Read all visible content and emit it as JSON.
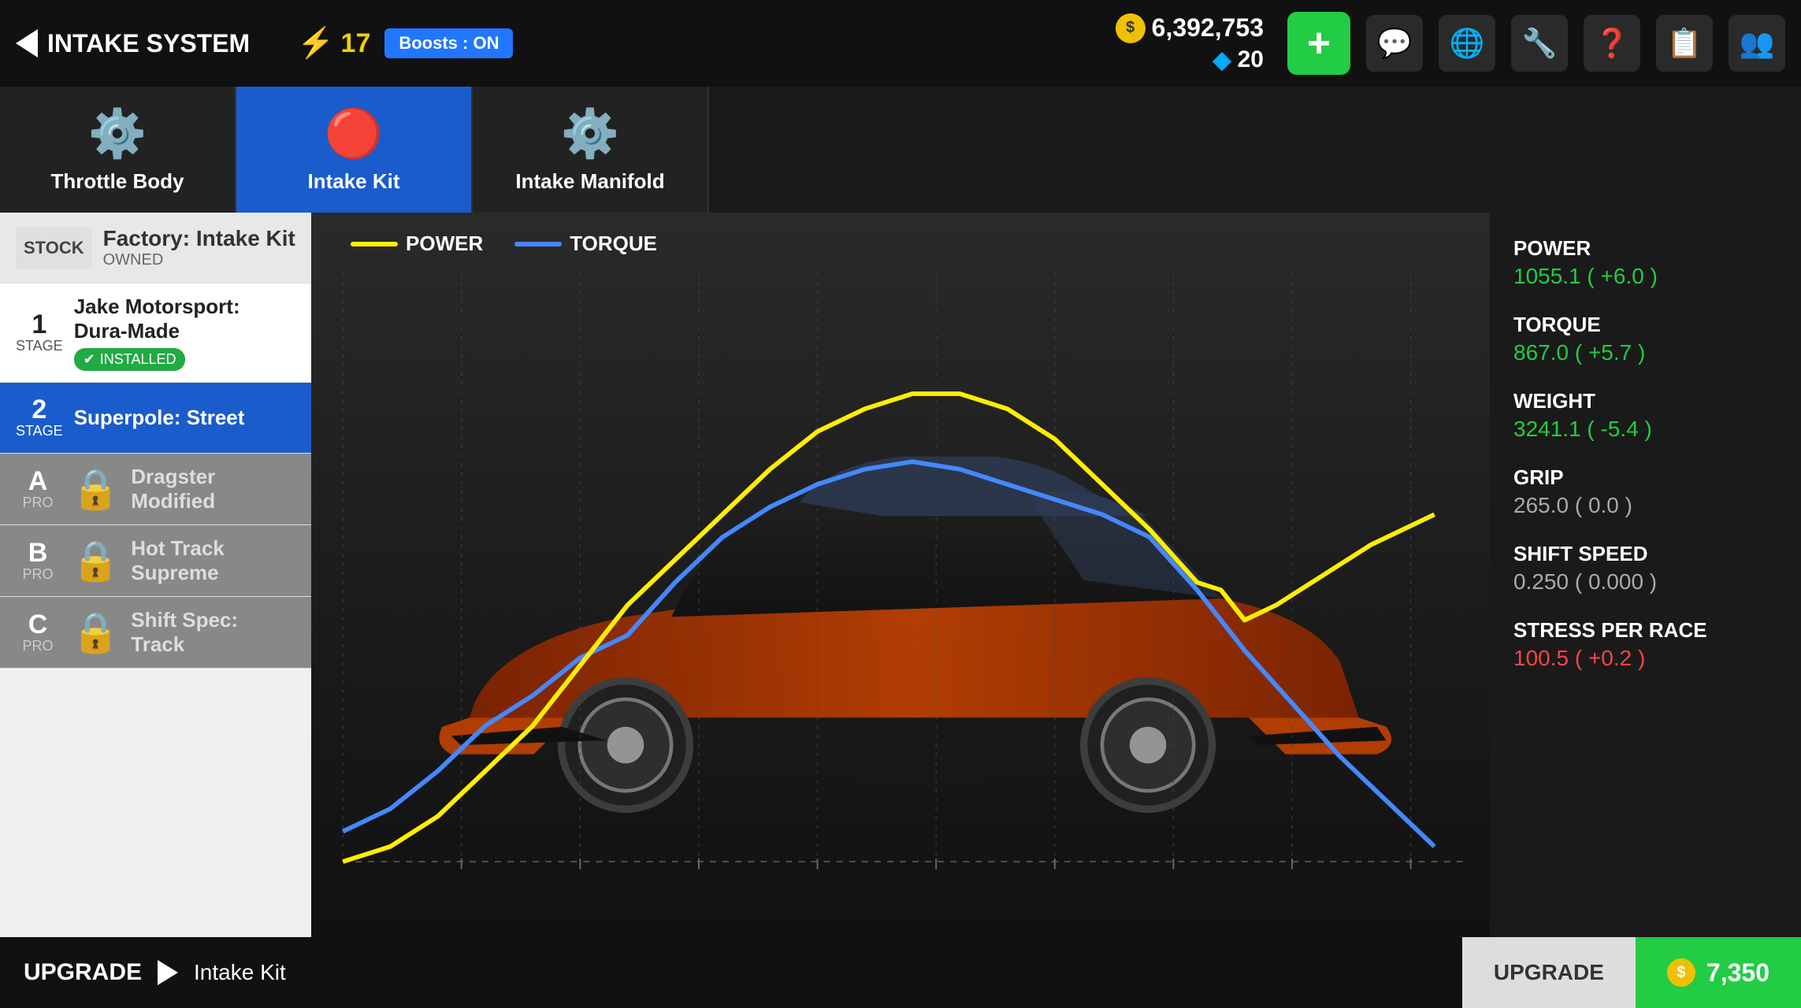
{
  "header": {
    "back_label": "INTAKE SYSTEM",
    "lightning_count": "17",
    "boosts_label": "Boosts : ON",
    "coins": "6,392,753",
    "gems": "20",
    "add_label": "+",
    "icons": [
      "💬",
      "🌐",
      "🔧",
      "❓",
      "📋",
      "👥"
    ]
  },
  "category_tabs": [
    {
      "id": "throttle-body",
      "label": "Throttle Body",
      "icon": "⚙️",
      "active": false
    },
    {
      "id": "intake-kit",
      "label": "Intake Kit",
      "icon": "🔴",
      "active": true
    },
    {
      "id": "intake-manifold",
      "label": "Intake Manifold",
      "icon": "⚙️",
      "active": false
    }
  ],
  "upgrade_list": [
    {
      "id": "stock",
      "type": "stock",
      "stage": "STOCK",
      "name": "Factory: Intake Kit",
      "sub": "OWNED",
      "locked": false,
      "installed": false,
      "active": false
    },
    {
      "id": "stage1",
      "type": "stage",
      "stage": "1",
      "stage_label": "STAGE",
      "name": "Jake Motorsport: Dura-Made",
      "sub": "",
      "locked": false,
      "installed": true,
      "active": false
    },
    {
      "id": "stage2",
      "type": "stage",
      "stage": "2",
      "stage_label": "STAGE",
      "name": "Superpole: Street",
      "sub": "",
      "locked": false,
      "installed": false,
      "active": true
    },
    {
      "id": "stagea",
      "type": "pro",
      "stage": "A",
      "stage_label": "PRO",
      "name": "Dragster Modified",
      "sub": "",
      "locked": true,
      "installed": false,
      "active": false
    },
    {
      "id": "stageb",
      "type": "pro",
      "stage": "B",
      "stage_label": "PRO",
      "name": "Hot Track Supreme",
      "sub": "",
      "locked": true,
      "installed": false,
      "active": false
    },
    {
      "id": "stagec",
      "type": "pro",
      "stage": "C",
      "stage_label": "PRO",
      "name": "Shift Spec: Track",
      "sub": "",
      "locked": true,
      "installed": false,
      "active": false
    }
  ],
  "chart": {
    "legend": {
      "power_label": "POWER",
      "torque_label": "TORQUE",
      "power_color": "#ffee00",
      "torque_color": "#4488ff"
    }
  },
  "stats": [
    {
      "id": "power",
      "name": "POWER",
      "value": "1055.1 ( +6.0 )",
      "type": "positive"
    },
    {
      "id": "torque",
      "name": "TORQUE",
      "value": "867.0 ( +5.7 )",
      "type": "positive"
    },
    {
      "id": "weight",
      "name": "WEIGHT",
      "value": "3241.1 ( -5.4 )",
      "type": "positive"
    },
    {
      "id": "grip",
      "name": "GRIP",
      "value": "265.0 ( 0.0 )",
      "type": "neutral"
    },
    {
      "id": "shift-speed",
      "name": "SHIFT SPEED",
      "value": "0.250 ( 0.000 )",
      "type": "neutral"
    },
    {
      "id": "stress",
      "name": "STRESS PER RACE",
      "value": "100.5 ( +0.2 )",
      "type": "negative"
    }
  ],
  "bottom_bar": {
    "upgrade_label": "UPGRADE",
    "item_label": "Intake Kit",
    "upgrade_btn_label": "UPGRADE",
    "price_label": "7,350"
  }
}
